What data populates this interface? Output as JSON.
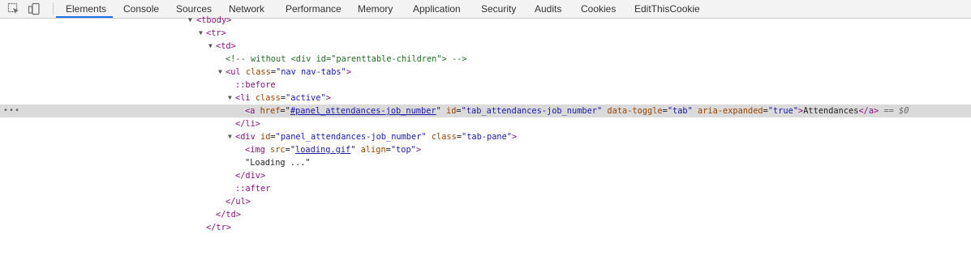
{
  "toolbar": {
    "icons": [
      "inspect-element-icon",
      "device-toolbar-icon"
    ],
    "tabs": [
      "Elements",
      "Console",
      "Sources",
      "Network",
      "Performance",
      "Memory",
      "Application",
      "Security",
      "Audits",
      "Cookies",
      "EditThisCookie"
    ],
    "active_tab": "Elements",
    "accent_color": "#1a73e8"
  },
  "dom_tree": {
    "tbody_open": "<tbody>",
    "tr_open": "<tr>",
    "td_open": "<td>",
    "comment": "<!-- without <div id=\"parenttable-children\"> -->",
    "ul_open_tag": "<ul",
    "ul_class_attr": "class",
    "ul_class_val": "\"nav nav-tabs\"",
    "before": "::before",
    "li_open_tag": "<li",
    "li_class_attr": "class",
    "li_class_val": "\"active\"",
    "a_open_tag": "<a",
    "a_href_attr": "href",
    "a_href_val": "#panel_attendances-job_number",
    "a_id_attr": "id",
    "a_id_val": "\"tab_attendances-job_number\"",
    "a_toggle_attr": "data-toggle",
    "a_toggle_val": "\"tab\"",
    "a_expanded_attr": "aria-expanded",
    "a_expanded_val": "\"true\"",
    "a_text": "Attendances",
    "a_close": "</a>",
    "selected_marker": "== $0",
    "li_close": "</li>",
    "div_open_tag": "<div",
    "div_id_attr": "id",
    "div_id_val": "\"panel_attendances-job_number\"",
    "div_class_attr": "class",
    "div_class_val": "\"tab-pane\"",
    "img_open_tag": "<img",
    "img_src_attr": "src",
    "img_src_val": "loading.gif",
    "img_align_attr": "align",
    "img_align_val": "\"top\"",
    "loading_text": "\"Loading ...\"",
    "div_close": "</div>",
    "after": "::after",
    "ul_close": "</ul>",
    "td_close": "</td>",
    "tr_close": "</tr>"
  }
}
